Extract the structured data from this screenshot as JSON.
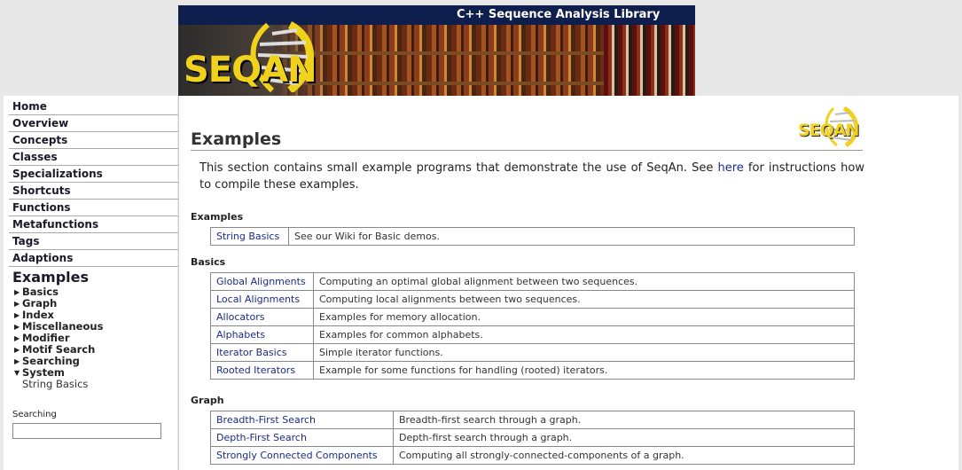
{
  "banner": {
    "subtitle": "C++ Sequence Analysis Library",
    "logo_text": "SEQAN"
  },
  "nav": {
    "items": [
      {
        "label": "Home"
      },
      {
        "label": "Overview"
      },
      {
        "label": "Concepts"
      },
      {
        "label": "Classes"
      },
      {
        "label": "Specializations"
      },
      {
        "label": "Shortcuts"
      },
      {
        "label": "Functions"
      },
      {
        "label": "Metafunctions"
      },
      {
        "label": "Tags"
      },
      {
        "label": "Adaptions"
      }
    ],
    "current": "Examples",
    "sub_items": [
      {
        "label": "Basics",
        "icon": "triangle-right-icon"
      },
      {
        "label": "Graph",
        "icon": "triangle-right-icon"
      },
      {
        "label": "Index",
        "icon": "triangle-right-icon"
      },
      {
        "label": "Miscellaneous",
        "icon": "triangle-right-icon"
      },
      {
        "label": "Modifier",
        "icon": "triangle-right-icon"
      },
      {
        "label": "Motif Search",
        "icon": "triangle-right-icon"
      },
      {
        "label": "Searching",
        "icon": "triangle-right-icon"
      },
      {
        "label": "System",
        "icon": "triangle-down-icon"
      }
    ],
    "sub_plain": "String Basics",
    "search_label": "Searching",
    "search_value": ""
  },
  "main": {
    "logo_text": "SEQAN",
    "title": "Examples",
    "intro_before": "This section contains small example programs that demonstrate the use of SeqAn. See ",
    "intro_link": "here",
    "intro_after": " for instructions how to compile these examples.",
    "sections": [
      {
        "heading": "Examples",
        "rows": [
          {
            "name": "String Basics",
            "desc": "See our Wiki for Basic demos."
          }
        ]
      },
      {
        "heading": "Basics",
        "rows": [
          {
            "name": "Global Alignments",
            "desc": "Computing an optimal global alignment between two sequences."
          },
          {
            "name": "Local Alignments",
            "desc": "Computing local alignments between two sequences."
          },
          {
            "name": "Allocators",
            "desc": "Examples for memory allocation."
          },
          {
            "name": "Alphabets",
            "desc": "Examples for common alphabets."
          },
          {
            "name": "Iterator Basics",
            "desc": "Simple iterator functions."
          },
          {
            "name": "Rooted Iterators",
            "desc": "Example for some functions for handling (rooted) iterators."
          }
        ]
      },
      {
        "heading": "Graph",
        "rows": [
          {
            "name": "Breadth-First Search",
            "desc": "Breadth-first search through a graph."
          },
          {
            "name": "Depth-First Search",
            "desc": "Depth-first search through a graph."
          },
          {
            "name": "Strongly Connected Components",
            "desc": "Computing all strongly-connected-components of a graph."
          }
        ]
      }
    ]
  },
  "colors": {
    "banner_bar": "#0f1f4d",
    "logo_yellow": "#f0d21c",
    "link": "#1a2a8a"
  }
}
